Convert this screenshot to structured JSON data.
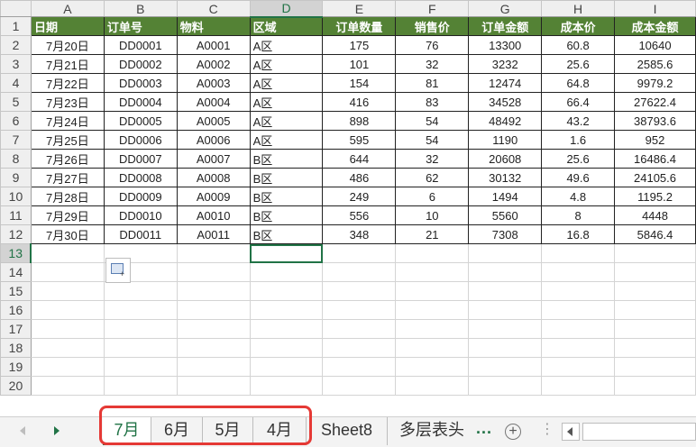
{
  "sheet": {
    "column_letters": [
      "A",
      "B",
      "C",
      "D",
      "E",
      "F",
      "G",
      "H",
      "I"
    ],
    "row_numbers": [
      "1",
      "2",
      "3",
      "4",
      "5",
      "6",
      "7",
      "8",
      "9",
      "10",
      "11",
      "12",
      "13",
      "14",
      "15",
      "16",
      "17",
      "18",
      "19",
      "20"
    ],
    "headers": [
      "日期",
      "订单号",
      "物料",
      "区域",
      "订单数量",
      "销售价",
      "订单金额",
      "成本价",
      "成本金额"
    ],
    "rows": [
      [
        "7月20日",
        "DD0001",
        "A0001",
        "A区",
        "175",
        "76",
        "13300",
        "60.8",
        "10640"
      ],
      [
        "7月21日",
        "DD0002",
        "A0002",
        "A区",
        "101",
        "32",
        "3232",
        "25.6",
        "2585.6"
      ],
      [
        "7月22日",
        "DD0003",
        "A0003",
        "A区",
        "154",
        "81",
        "12474",
        "64.8",
        "9979.2"
      ],
      [
        "7月23日",
        "DD0004",
        "A0004",
        "A区",
        "416",
        "83",
        "34528",
        "66.4",
        "27622.4"
      ],
      [
        "7月24日",
        "DD0005",
        "A0005",
        "A区",
        "898",
        "54",
        "48492",
        "43.2",
        "38793.6"
      ],
      [
        "7月25日",
        "DD0006",
        "A0006",
        "A区",
        "595",
        "54",
        "1190",
        "1.6",
        "952"
      ],
      [
        "7月26日",
        "DD0007",
        "A0007",
        "B区",
        "644",
        "32",
        "20608",
        "25.6",
        "16486.4"
      ],
      [
        "7月27日",
        "DD0008",
        "A0008",
        "B区",
        "486",
        "62",
        "30132",
        "49.6",
        "24105.6"
      ],
      [
        "7月28日",
        "DD0009",
        "A0009",
        "B区",
        "249",
        "6",
        "1494",
        "4.8",
        "1195.2"
      ],
      [
        "7月29日",
        "DD0010",
        "A0010",
        "B区",
        "556",
        "10",
        "5560",
        "8",
        "4448"
      ],
      [
        "7月30日",
        "DD0011",
        "A0011",
        "B区",
        "348",
        "21",
        "7308",
        "16.8",
        "5846.4"
      ]
    ],
    "active_cell": "D13",
    "header_fill": "#548235",
    "selection_color": "#217346"
  },
  "tabs": {
    "items": [
      "7月",
      "6月",
      "5月",
      "4月",
      "Sheet8",
      "多层表头"
    ],
    "active_index": 0,
    "more": "..."
  },
  "icons": {
    "paste_options": "paste-options-icon",
    "add_sheet": "plus-circle-icon",
    "nav_prev": "triangle-left-icon",
    "nav_next": "triangle-right-icon"
  }
}
